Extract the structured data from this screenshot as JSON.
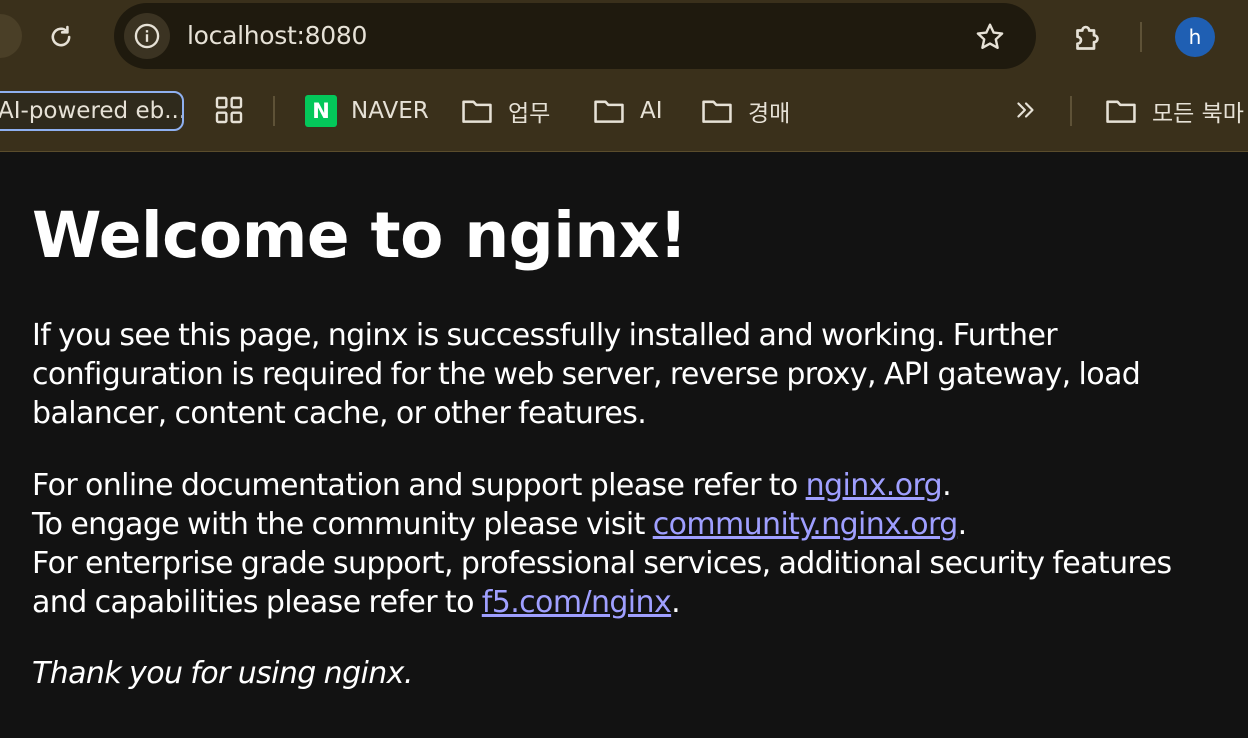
{
  "browser": {
    "url": "localhost:8080",
    "avatar_initial": "h",
    "accent_color": "#1f5fb3",
    "icons": {
      "back": "back-arrow-icon",
      "reload": "reload-icon",
      "site_info": "info-icon",
      "bookmark_star": "star-icon",
      "extensions": "puzzle-icon",
      "apps": "apps-grid-icon",
      "more": "double-chevron-icon"
    }
  },
  "bookmarks": {
    "active_tab_label": "AI-powered eb...",
    "items": [
      {
        "label": "NAVER",
        "icon": "naver-logo-icon"
      },
      {
        "label": "업무",
        "icon": "folder-icon"
      },
      {
        "label": "AI",
        "icon": "folder-icon"
      },
      {
        "label": "경매",
        "icon": "folder-icon"
      }
    ],
    "all_bookmarks_label": "모든 북마"
  },
  "page": {
    "title": "Welcome to nginx!",
    "intro": "If you see this page, nginx is successfully installed and working. Further configuration is required for the web server, reverse proxy, API gateway, load balancer, content cache, or other features.",
    "docs_text": "For online documentation and support please refer to ",
    "docs_link": "nginx.org",
    "community_text": "To engage with the community please visit ",
    "community_link": "community.nginx.org",
    "enterprise_text": "For enterprise grade support, professional services, additional security features and capabilities please refer to ",
    "enterprise_link": "f5.com/nginx",
    "period": ".",
    "thanks": "Thank you for using nginx.",
    "link_color": "#9f9fff"
  }
}
